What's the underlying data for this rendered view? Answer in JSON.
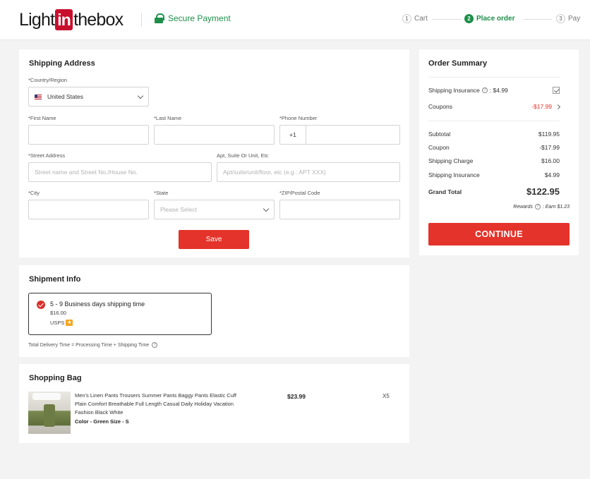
{
  "header": {
    "logo_left": "Light",
    "logo_mid": "in",
    "logo_right": "thebox",
    "secure_label": "Secure Payment",
    "steps": [
      {
        "num": "1",
        "label": "Cart"
      },
      {
        "num": "2",
        "label": "Place order"
      },
      {
        "num": "3",
        "label": "Pay"
      }
    ],
    "active_step": 2
  },
  "shipping_address": {
    "title": "Shipping Address",
    "country_label": "*Country/Region",
    "country_value": "United States",
    "first_name_label": "*First Name",
    "last_name_label": "*Last Name",
    "phone_label": "*Phone Number",
    "phone_prefix": "+1",
    "street_label": "*Street Address",
    "street_placeholder": "Street name and Street No./House No.",
    "apt_label": "Apt, Suite Or Unit, Etc",
    "apt_placeholder": "Apt/suite/unit/floor, etc (e.g.: APT XXX)",
    "city_label": "*City",
    "state_label": "*State",
    "state_placeholder": "Please Select",
    "zip_label": "*ZIP/Postal Code",
    "save_label": "Save"
  },
  "shipment_info": {
    "title": "Shipment Info",
    "option_name": "5 - 9 Business days shipping time",
    "option_price": "$16.00",
    "carrier": "USPS",
    "total_time_note": "Total Delivery Time = Processing Time + Shipping Time"
  },
  "shopping_bag": {
    "title": "Shopping Bag",
    "items": [
      {
        "name": "Men's Linen Pants Trousers Summer Pants Baggy Pants Elastic Cuff Plain Comfort Breathable Full Length Casual Daily Holiday Vacation Fashion Black White",
        "attrs": "Color - Green   Size - S",
        "price": "$23.99",
        "qty": "X5"
      }
    ]
  },
  "order_summary": {
    "title": "Order Summary",
    "insurance_label": "Shipping Insurance",
    "insurance_value": ": $4.99",
    "coupons_label": "Coupons",
    "coupons_value": "-$17.99",
    "subtotal_label": "Subtotal",
    "subtotal_value": "$119.95",
    "coupon_label": "Coupon",
    "coupon_value": "-$17.99",
    "shipping_charge_label": "Shipping Charge",
    "shipping_charge_value": "$16.00",
    "shipping_insurance_label": "Shipping Insurance",
    "shipping_insurance_value": "$4.99",
    "grand_total_label": "Grand Total",
    "grand_total_value": "$122.95",
    "rewards_label": "Rewards",
    "rewards_value": ": Earn $1.23",
    "continue_label": "CONTINUE"
  },
  "colors": {
    "accent": "#e4332a",
    "secure_green": "#1d8f4a",
    "logo_red": "#c8102e"
  }
}
